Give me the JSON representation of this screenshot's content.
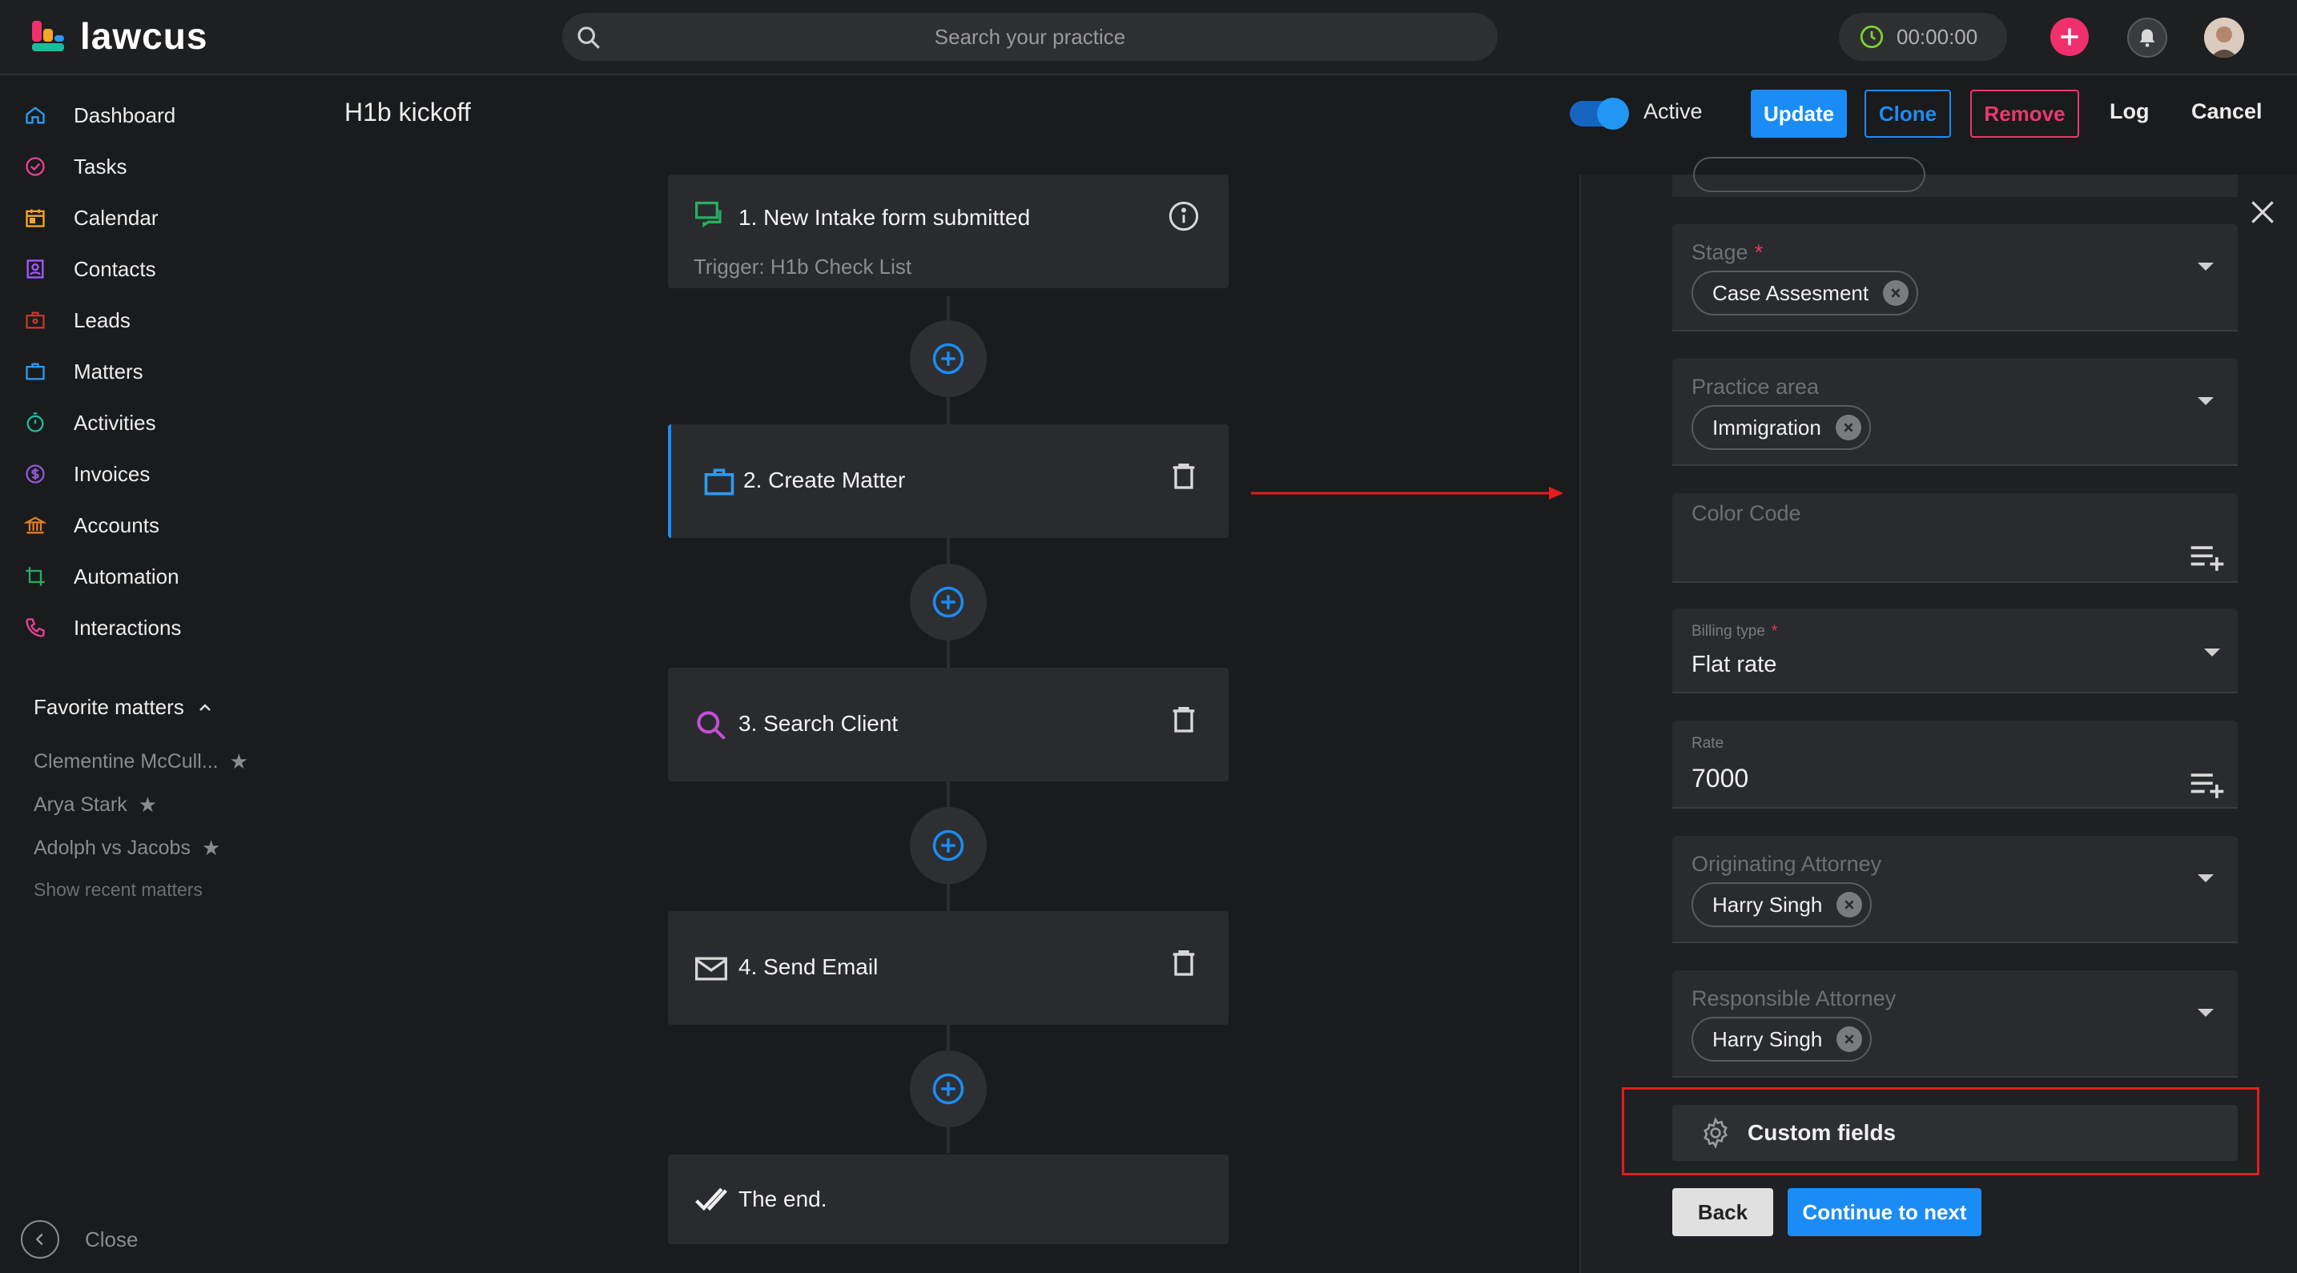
{
  "app": {
    "name": "lawcus"
  },
  "topbar": {
    "search_placeholder": "Search your practice",
    "timer": "00:00:00",
    "icons": {
      "search": "search-icon",
      "clock": "clock-icon",
      "add": "plus-icon",
      "bell": "bell-icon",
      "avatar": "user-avatar"
    }
  },
  "sidebar": {
    "items": [
      {
        "label": "Dashboard",
        "icon": "home-icon",
        "color": "#2b9af3"
      },
      {
        "label": "Tasks",
        "icon": "check-circle-icon",
        "color": "#e84393"
      },
      {
        "label": "Calendar",
        "icon": "calendar-icon",
        "color": "#f5a623"
      },
      {
        "label": "Contacts",
        "icon": "contacts-icon",
        "color": "#a259ff"
      },
      {
        "label": "Leads",
        "icon": "leads-icon",
        "color": "#c0392b"
      },
      {
        "label": "Matters",
        "icon": "briefcase-icon",
        "color": "#2b9af3"
      },
      {
        "label": "Activities",
        "icon": "stopwatch-icon",
        "color": "#1abc9c"
      },
      {
        "label": "Invoices",
        "icon": "dollar-icon",
        "color": "#8e5bd6"
      },
      {
        "label": "Accounts",
        "icon": "bank-icon",
        "color": "#e67e22"
      },
      {
        "label": "Automation",
        "icon": "automation-icon",
        "color": "#27ae60"
      },
      {
        "label": "Interactions",
        "icon": "phone-icon",
        "color": "#e84393"
      }
    ],
    "favorites_header": "Favorite matters",
    "favorites": [
      {
        "label": "Clementine McCull..."
      },
      {
        "label": "Arya Stark"
      },
      {
        "label": "Adolph vs Jacobs"
      }
    ],
    "show_recent": "Show recent matters",
    "close_label": "Close"
  },
  "header": {
    "title": "H1b kickoff",
    "active_label": "Active",
    "active": true,
    "buttons": {
      "update": "Update",
      "clone": "Clone",
      "remove": "Remove",
      "log": "Log",
      "cancel": "Cancel"
    }
  },
  "workflow": {
    "steps": [
      {
        "title": "1. New Intake form submitted",
        "subtitle": "Trigger: H1b Check List",
        "icon": "chat-icon",
        "action": "info-icon"
      },
      {
        "title": "2. Create Matter",
        "icon": "briefcase-icon",
        "action": "trash-icon",
        "selected": true
      },
      {
        "title": "3. Search Client",
        "icon": "search-icon",
        "action": "trash-icon"
      },
      {
        "title": "4. Send Email",
        "icon": "mail-icon",
        "action": "trash-icon"
      },
      {
        "title": "The end.",
        "icon": "double-check-icon"
      }
    ]
  },
  "panel": {
    "stage": {
      "label": "Stage",
      "value": "Case Assesment"
    },
    "practice_area": {
      "label": "Practice area",
      "value": "Immigration"
    },
    "color_code": {
      "label": "Color Code"
    },
    "billing_type": {
      "label": "Billing type",
      "value": "Flat rate"
    },
    "rate": {
      "label": "Rate",
      "value": "7000"
    },
    "originating_attorney": {
      "label": "Originating Attorney",
      "value": "Harry Singh"
    },
    "responsible_attorney": {
      "label": "Responsible Attorney",
      "value": "Harry Singh"
    },
    "custom_fields_label": "Custom fields",
    "back_label": "Back",
    "next_label": "Continue to next"
  },
  "colors": {
    "accent": "#1b8cf5",
    "danger": "#e83a6c",
    "highlight": "#e31c1c",
    "background": "#1a1b1d"
  }
}
